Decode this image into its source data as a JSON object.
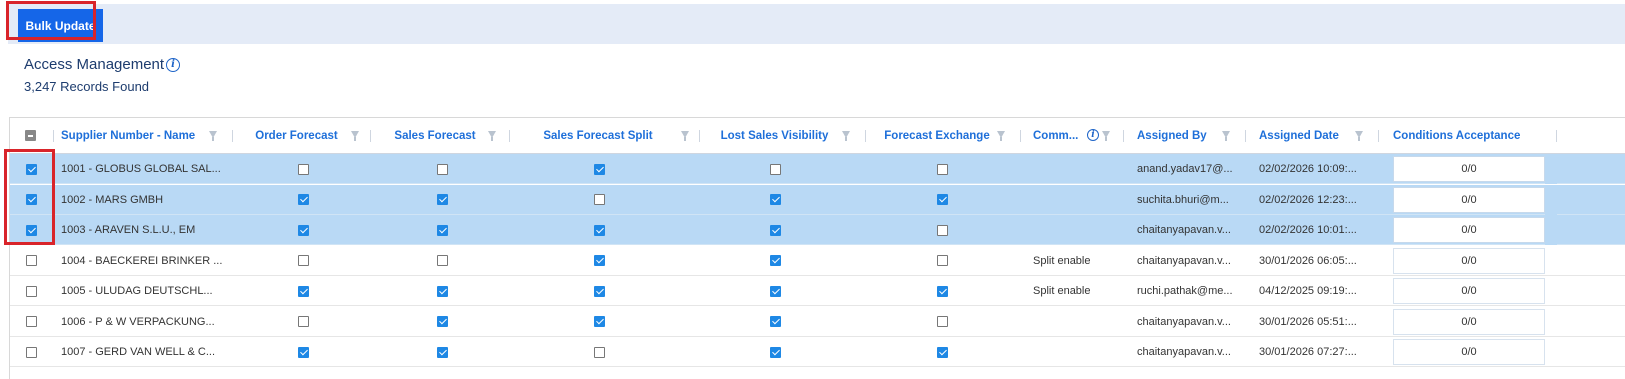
{
  "toolbar": {
    "bulk_update_label": "Bulk Update"
  },
  "page": {
    "title": "Access Management",
    "records_text": "3,247 Records Found"
  },
  "columns": [
    {
      "label": "Supplier Number - Name"
    },
    {
      "label": "Order Forecast"
    },
    {
      "label": "Sales Forecast"
    },
    {
      "label": "Sales Forecast Split"
    },
    {
      "label": "Lost Sales Visibility"
    },
    {
      "label": "Forecast Exchange"
    },
    {
      "label": "Comm..."
    },
    {
      "label": "Assigned By"
    },
    {
      "label": "Assigned Date"
    },
    {
      "label": "Conditions Acceptance"
    }
  ],
  "rows": [
    {
      "selected": true,
      "supplier": "1001 - GLOBUS GLOBAL SAL...",
      "order_forecast": false,
      "sales_forecast": false,
      "sales_forecast_split": true,
      "lost_sales_visibility": false,
      "forecast_exchange": false,
      "comment": "",
      "assigned_by": "anand.yadav17@...",
      "assigned_date": "02/02/2026 10:09:...",
      "conditions": "0/0"
    },
    {
      "selected": true,
      "supplier": "1002 - MARS GMBH",
      "order_forecast": true,
      "sales_forecast": true,
      "sales_forecast_split": false,
      "lost_sales_visibility": true,
      "forecast_exchange": true,
      "comment": "",
      "assigned_by": "suchita.bhuri@m...",
      "assigned_date": "02/02/2026 12:23:...",
      "conditions": "0/0"
    },
    {
      "selected": true,
      "supplier": "1003 - ARAVEN S.L.U., EM",
      "order_forecast": true,
      "sales_forecast": true,
      "sales_forecast_split": true,
      "lost_sales_visibility": true,
      "forecast_exchange": false,
      "comment": "",
      "assigned_by": "chaitanyapavan.v...",
      "assigned_date": "02/02/2026 10:01:...",
      "conditions": "0/0"
    },
    {
      "selected": false,
      "supplier": "1004 - BAECKEREI BRINKER ...",
      "order_forecast": false,
      "sales_forecast": false,
      "sales_forecast_split": true,
      "lost_sales_visibility": true,
      "forecast_exchange": false,
      "comment": "Split enable",
      "assigned_by": "chaitanyapavan.v...",
      "assigned_date": "30/01/2026 06:05:...",
      "conditions": "0/0"
    },
    {
      "selected": false,
      "supplier": "1005 - ULUDAG DEUTSCHL...",
      "order_forecast": true,
      "sales_forecast": true,
      "sales_forecast_split": true,
      "lost_sales_visibility": true,
      "forecast_exchange": true,
      "comment": "Split enable",
      "assigned_by": "ruchi.pathak@me...",
      "assigned_date": "04/12/2025 09:19:...",
      "conditions": "0/0"
    },
    {
      "selected": false,
      "supplier": "1006 - P & W VERPACKUNG...",
      "order_forecast": false,
      "sales_forecast": true,
      "sales_forecast_split": true,
      "lost_sales_visibility": true,
      "forecast_exchange": false,
      "comment": "",
      "assigned_by": "chaitanyapavan.v...",
      "assigned_date": "30/01/2026 05:51:...",
      "conditions": "0/0"
    },
    {
      "selected": false,
      "supplier": "1007 - GERD VAN WELL & C...",
      "order_forecast": true,
      "sales_forecast": true,
      "sales_forecast_split": false,
      "lost_sales_visibility": true,
      "forecast_exchange": true,
      "comment": "",
      "assigned_by": "chaitanyapavan.v...",
      "assigned_date": "30/01/2026 07:27:...",
      "conditions": "0/0"
    }
  ],
  "colors": {
    "accent": "#1566e8",
    "highlight": "#d9242a",
    "selected_row": "#b9d9f5",
    "header_text": "#1e6fd9"
  },
  "icons": [
    "info-icon",
    "filter-icon",
    "checkbox-icon"
  ]
}
